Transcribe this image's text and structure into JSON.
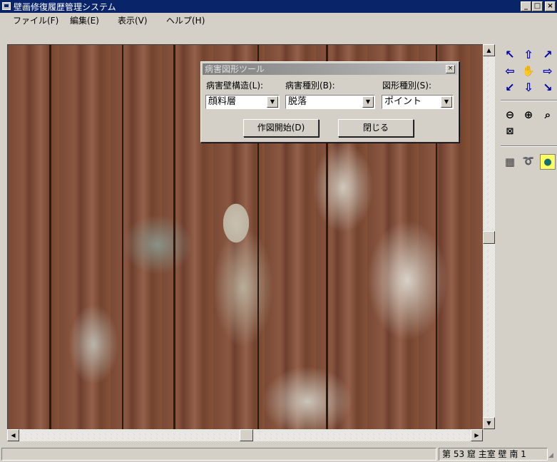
{
  "window": {
    "title": "壁画修復履歴管理システム",
    "controls": {
      "minimize": "_",
      "maximize": "□",
      "close": "×"
    }
  },
  "menubar": {
    "items": [
      {
        "label": "ファイル(F)"
      },
      {
        "label": "編集(E)"
      },
      {
        "label": "表示(V)"
      },
      {
        "label": "ヘルプ(H)"
      }
    ]
  },
  "dialog": {
    "title": "病害図形ツール",
    "close_glyph": "×",
    "fields": [
      {
        "label": "病害壁構造(L):",
        "value": "顔料層"
      },
      {
        "label": "病害種別(B):",
        "value": "脱落"
      },
      {
        "label": "図形種別(S):",
        "value": "ポイント"
      }
    ],
    "buttons": {
      "start": "作図開始(D)",
      "close": "閉じる"
    }
  },
  "toolbar": {
    "nav_icons": [
      "arrow-up-left-icon",
      "arrow-up-icon",
      "arrow-up-right-icon",
      "arrow-left-icon",
      "hand-pan-icon",
      "arrow-right-icon",
      "arrow-down-left-icon",
      "arrow-down-icon",
      "arrow-down-right-icon"
    ],
    "zoom_icons": [
      "zoom-out-icon",
      "zoom-in-icon",
      "zoom-fit-icon",
      "zoom-region-icon"
    ],
    "draw_icons": [
      "grid-icon",
      "lasso-icon",
      "fill-shape-icon"
    ],
    "accent_color": "#0000a8"
  },
  "scrollbars": {
    "up_arrow": "▲",
    "down_arrow": "▼",
    "left_arrow": "◀",
    "right_arrow": "▶"
  },
  "statusbar": {
    "left_text": "",
    "location": "第 53 窟 主室 壁 南 1"
  }
}
